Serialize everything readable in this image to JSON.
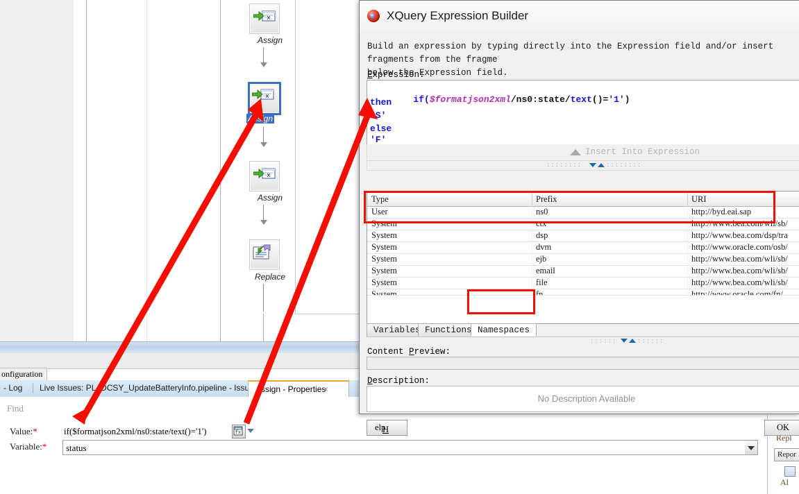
{
  "dialog": {
    "title": "XQuery Expression Builder",
    "icon": "oracle-orb-icon",
    "blurb_line1": "Build an expression by typing directly into the Expression field and/or insert fragments from the fragme",
    "blurb_line2": "below the Expression field.",
    "expression_label": "Expression:",
    "expression_lines": [
      {
        "id": "l1",
        "seg": [
          {
            "t": "if(",
            "c": "kw"
          },
          {
            "t": "$formatjson2xml",
            "c": "var"
          },
          {
            "t": "/ns0:state/",
            "c": "pth"
          },
          {
            "t": "text",
            "c": "fn"
          },
          {
            "t": "()=",
            "c": "pth"
          },
          {
            "t": "'1'",
            "c": "str"
          },
          {
            "t": ")",
            "c": "pth"
          }
        ]
      },
      {
        "id": "l2",
        "seg": [
          {
            "t": "then",
            "c": "kw"
          }
        ]
      },
      {
        "id": "l3",
        "seg": [
          {
            "t": "'S'",
            "c": "str"
          }
        ]
      },
      {
        "id": "l4",
        "seg": [
          {
            "t": "else",
            "c": "kw"
          }
        ]
      },
      {
        "id": "l5",
        "seg": [
          {
            "t": "'F'",
            "c": "str"
          }
        ]
      }
    ],
    "expression_plain": "if($formatjson2xml/ns0:state/text()='1')\nthen\n'S'\nelse\n'F'",
    "insert_button": "Insert Into Expression",
    "table": {
      "columns": [
        "Type",
        "Prefix",
        "URI"
      ],
      "rows": [
        {
          "type": "User",
          "prefix": "ns0",
          "uri": "http://byd.eai.sap"
        },
        {
          "type": "System",
          "prefix": "ctx",
          "uri": "http://www.bea.com/wli/sb/"
        },
        {
          "type": "System",
          "prefix": "dsp",
          "uri": "http://www.bea.com/dsp/tra"
        },
        {
          "type": "System",
          "prefix": "dvm",
          "uri": "http://www.oracle.com/osb/"
        },
        {
          "type": "System",
          "prefix": "ejb",
          "uri": "http://www.bea.com/wli/sb/"
        },
        {
          "type": "System",
          "prefix": "email",
          "uri": "http://www.bea.com/wli/sb/"
        },
        {
          "type": "System",
          "prefix": "file",
          "uri": "http://www.bea.com/wli/sb/"
        },
        {
          "type": "System",
          "prefix": "fn",
          "uri": "http://www.oracle.com/fn/"
        }
      ]
    },
    "tabs": [
      {
        "label": "Variables",
        "active": false
      },
      {
        "label": "Functions",
        "active": false
      },
      {
        "label": "Namespaces",
        "active": true
      }
    ],
    "content_preview_label": "Content Preview:",
    "content_preview_value": "",
    "description_label": "Description:",
    "description_value": "No Description Available",
    "help_button": "Help",
    "ok_button": "OK"
  },
  "flow": {
    "nodes": [
      {
        "label": "Assign",
        "icon": "assign-icon",
        "selected": false
      },
      {
        "label": "Assign",
        "icon": "assign-icon",
        "selected": true
      },
      {
        "label": "Assign",
        "icon": "assign-icon",
        "selected": false
      },
      {
        "label": "Replace",
        "icon": "replace-icon",
        "selected": false
      }
    ]
  },
  "ide": {
    "configuration_tab": "onfiguration",
    "log_tab": "- Log",
    "issues_tab": "Live Issues: PL_DCSY_UpdateBatteryInfo.pipeline - Issues",
    "properties_tab": "Assign - Properties",
    "properties_tab_close": "×",
    "find_placeholder": "Find"
  },
  "properties": {
    "value_label": "Value:",
    "value_required": "*",
    "value_text": "if($formatjson2xml/ns0:state/text()='1')",
    "value_icon": "expression-builder-icon",
    "variable_label": "Variable:",
    "variable_required": "*",
    "variable_value": "status"
  },
  "rail": {
    "replace_text": "Repl",
    "report_button": "Repor",
    "alert_text": "Al"
  },
  "colors": {
    "annotation": "#f50d00",
    "selection": "#3a6fc4",
    "keyword": "#1414d2",
    "variable": "#b22fb2",
    "tab_accent": "#e8a33d"
  }
}
